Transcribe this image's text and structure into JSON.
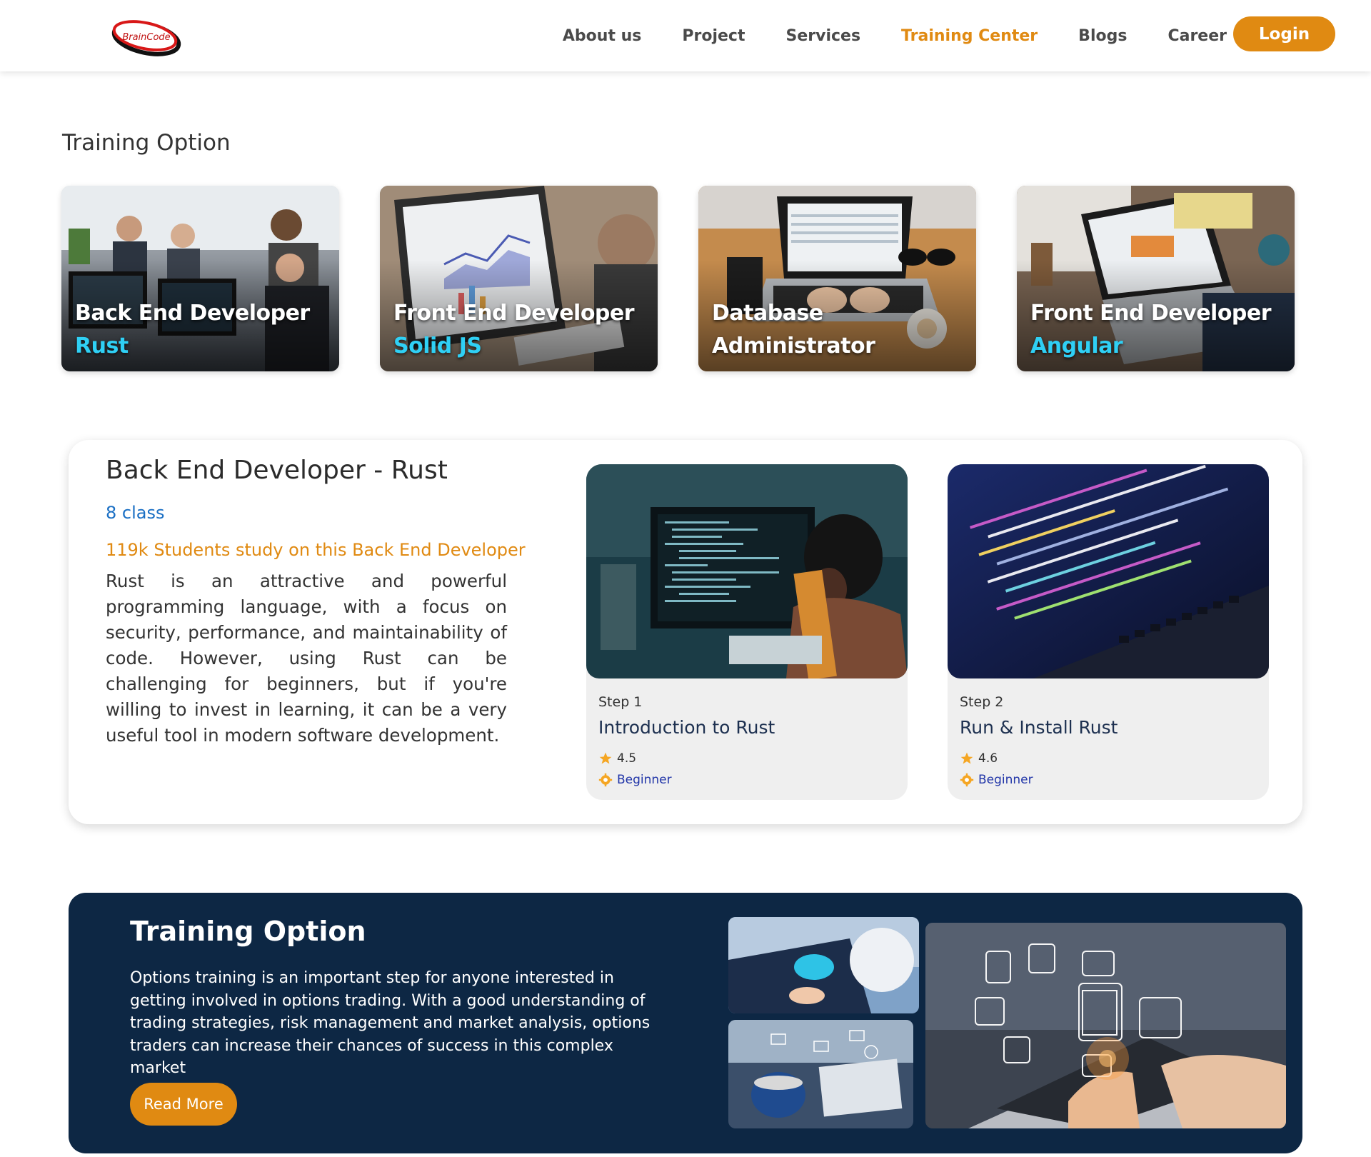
{
  "nav": {
    "logo_text": "BrainCode",
    "links": [
      "About us",
      "Project",
      "Services",
      "Training Center",
      "Blogs",
      "Career"
    ],
    "active": "Training Center",
    "login_label": "Login"
  },
  "training": {
    "title": "Training Option",
    "cards": [
      {
        "line1": "Back End Developer",
        "line2": "Rust"
      },
      {
        "line1": "Front End Developer",
        "line2": "Solid JS"
      },
      {
        "line1": "Database",
        "line2": "Administrator"
      },
      {
        "line1": "Front End Developer",
        "line2": "Angular"
      }
    ]
  },
  "detail": {
    "title": "Back End Developer - Rust",
    "classes": "8 class",
    "students": "119k Students study on this Back End Developer",
    "description": "Rust is an attractive and powerful programming language, with a focus on security, performance, and maintainability of code. However, using Rust can be challenging for beginners, but if you're willing to invest in learning, it can be a very useful tool in modern software development.",
    "steps": [
      {
        "step": "Step 1",
        "title": "Introduction to Rust",
        "rating": "4.5",
        "level": "Beginner"
      },
      {
        "step": "Step 2",
        "title": "Run & Install Rust",
        "rating": "4.6",
        "level": "Beginner"
      }
    ]
  },
  "banner": {
    "title": "Training Option",
    "text": "Options training is an important step for anyone interested in getting involved in options trading. With a good understanding of trading strategies, risk management and market analysis, options traders can increase their chances of success in this complex market",
    "button": "Read More"
  },
  "colors": {
    "accent": "#e08a12",
    "cyan": "#2fd0f5",
    "navy": "#0d2744",
    "link_blue": "#1a6fc4"
  }
}
